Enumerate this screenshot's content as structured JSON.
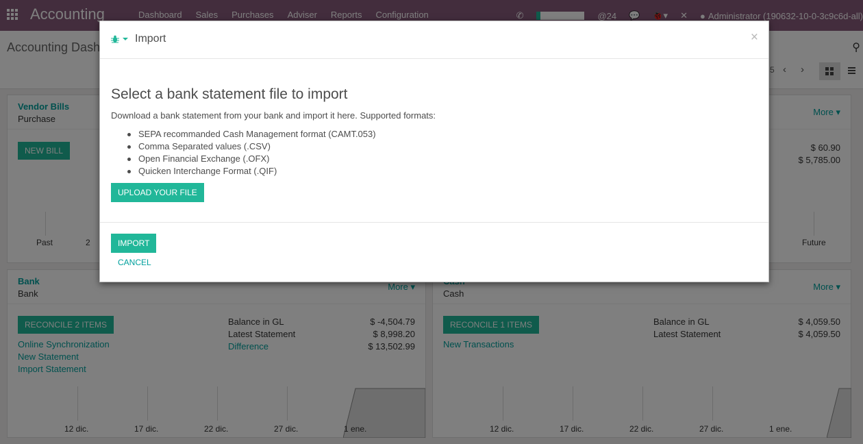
{
  "navbar": {
    "app_name": "Accounting",
    "menu": [
      "Dashboard",
      "Sales",
      "Purchases",
      "Adviser",
      "Reports",
      "Configuration"
    ],
    "messages_count": "@24",
    "user": "Administrator (190632-10-0-3c9c6d-all)",
    "accent": "#875a7b"
  },
  "control": {
    "title": "Accounting Dashboard",
    "pager": "5"
  },
  "cards": {
    "vendor_bills": {
      "title": "Vendor Bills",
      "subtitle": "Purchase",
      "button": "NEW BILL",
      "axis_left": "Past",
      "axis_second": "2"
    },
    "customer": {
      "more": "More",
      "amount1": "$ 60.90",
      "amount2": "$ 5,785.00",
      "axis_right": "Future"
    },
    "bank": {
      "title": "Bank",
      "subtitle": "Bank",
      "more": "More",
      "button": "RECONCILE 2 ITEMS",
      "links": [
        "Online Synchronization",
        "New Statement",
        "Import Statement"
      ],
      "balance_label": "Balance in GL",
      "balance_value": "$ -4,504.79",
      "latest_label": "Latest Statement",
      "latest_value": "$ 8,998.20",
      "difference_label": "Difference",
      "difference_value": "$ 13,502.99",
      "axis": [
        "12 dic.",
        "17 dic.",
        "22 dic.",
        "27 dic.",
        "1 ene."
      ]
    },
    "cash": {
      "title": "Cash",
      "subtitle": "Cash",
      "more": "More",
      "button": "RECONCILE 1 ITEMS",
      "link": "New Transactions",
      "balance_label": "Balance in GL",
      "balance_value": "$ 4,059.50",
      "latest_label": "Latest Statement",
      "latest_value": "$ 4,059.50",
      "axis": [
        "12 dic.",
        "17 dic.",
        "22 dic.",
        "27 dic.",
        "1 ene."
      ]
    }
  },
  "modal": {
    "title": "Import",
    "close": "×",
    "heading": "Select a bank statement file to import",
    "description": "Download a bank statement from your bank and import it here. Supported formats:",
    "formats": [
      "SEPA recommanded Cash Management format (CAMT.053)",
      "Comma Separated values (.CSV)",
      "Open Financial Exchange (.OFX)",
      "Quicken Interchange Format (.QIF)"
    ],
    "upload_label": "UPLOAD YOUR FILE",
    "import_label": "IMPORT",
    "cancel_label": "CANCEL",
    "accent": "#21b799"
  }
}
